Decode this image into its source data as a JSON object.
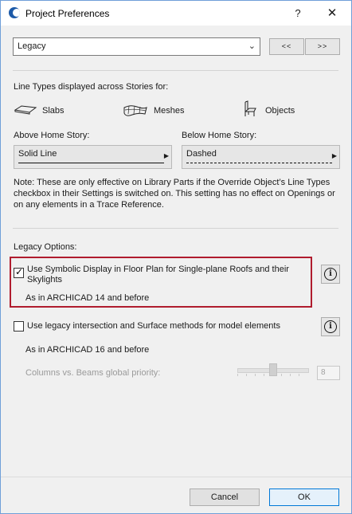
{
  "window": {
    "title": "Project Preferences",
    "help": "?",
    "close": "✕"
  },
  "preset": {
    "value": "Legacy",
    "prev_label": "<<",
    "next_label": ">>"
  },
  "line_types": {
    "heading": "Line Types displayed across Stories for:",
    "items": [
      {
        "label": "Slabs",
        "icon": "slab-icon"
      },
      {
        "label": "Meshes",
        "icon": "mesh-icon"
      },
      {
        "label": "Objects",
        "icon": "chair-icon"
      }
    ],
    "above": {
      "label": "Above Home Story:",
      "value": "Solid Line"
    },
    "below": {
      "label": "Below Home Story:",
      "value": "Dashed"
    },
    "note": "Note: These are only effective on Library Parts if the Override Object’s Line Types checkbox in their Settings is switched on. This setting has no effect on Openings or on any elements in a Trace Reference."
  },
  "legacy": {
    "heading": "Legacy Options:",
    "option1": {
      "checked": true,
      "label": "Use Symbolic Display in Floor Plan for Single-plane Roofs and their Skylights",
      "subtext": "As in ARCHICAD 14 and before"
    },
    "option2": {
      "checked": false,
      "label": "Use legacy intersection and Surface methods for model elements",
      "subtext": "As in ARCHICAD 16 and before"
    },
    "priority": {
      "label": "Columns vs. Beams global priority:",
      "value": "8"
    }
  },
  "footer": {
    "cancel": "Cancel",
    "ok": "OK"
  },
  "colors": {
    "highlight": "#b01c2e",
    "ok_border": "#0078d7",
    "window_border": "#6f9fd8"
  }
}
